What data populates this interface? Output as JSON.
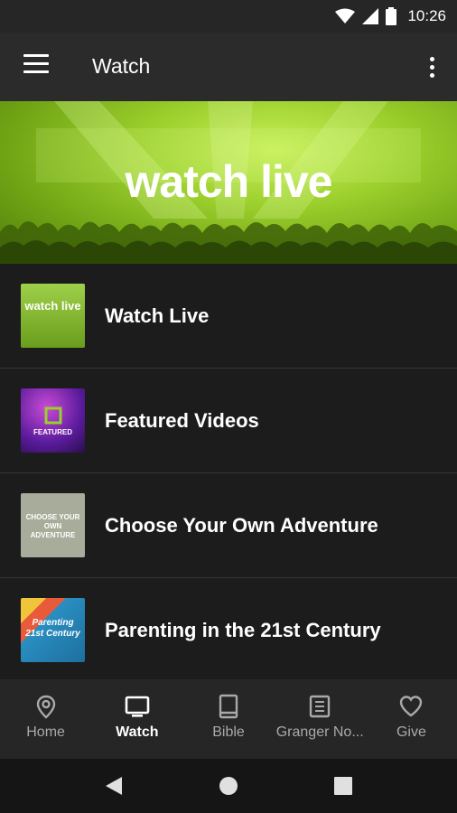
{
  "status_bar": {
    "time": "10:26"
  },
  "app_bar": {
    "title": "Watch"
  },
  "hero": {
    "title": "watch live"
  },
  "list": {
    "items": [
      {
        "label": "Watch Live",
        "thumb_text": "watch live",
        "thumb_color": "#8cc63f"
      },
      {
        "label": "Featured Videos",
        "thumb_text": "FEATURED",
        "thumb_color": "#6b2bb0"
      },
      {
        "label": "Choose Your Own Adventure",
        "thumb_text": "CHOOSE YOUR OWN ADVENTURE",
        "thumb_color": "#a7ad9a"
      },
      {
        "label": "Parenting in the 21st Century",
        "thumb_text": "Parenting 21st Century",
        "thumb_color": "#2a8fc2"
      }
    ]
  },
  "bottom_nav": {
    "items": [
      {
        "label": "Home",
        "icon": "location-pin-icon",
        "active": false
      },
      {
        "label": "Watch",
        "icon": "tv-icon",
        "active": true
      },
      {
        "label": "Bible",
        "icon": "book-icon",
        "active": false
      },
      {
        "label": "Granger No...",
        "icon": "notes-icon",
        "active": false
      },
      {
        "label": "Give",
        "icon": "heart-icon",
        "active": false
      }
    ]
  },
  "colors": {
    "accent": "#9bcf2c",
    "background": "#1c1c1c",
    "app_bar": "#2b2b2b"
  }
}
